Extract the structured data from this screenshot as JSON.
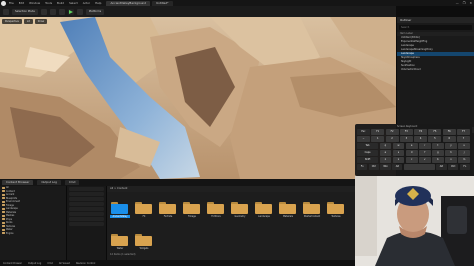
{
  "titlebar": {
    "menus": [
      "File",
      "Edit",
      "Window",
      "Tools",
      "Build",
      "Select",
      "Actor",
      "Help"
    ],
    "tabs": [
      "AncientValleyBackground",
      "Untitled*"
    ],
    "window_controls": [
      "—",
      "❐",
      "✕"
    ]
  },
  "toolbar": {
    "mode": "Selection Mode",
    "platforms": "Platforms",
    "icons": [
      "save-icon",
      "content-icon",
      "blueprint-icon",
      "cinematics-icon",
      "play-icon",
      "launch-icon"
    ]
  },
  "viewport": {
    "chips": [
      "Perspective",
      "Lit",
      "Show"
    ],
    "colors": {
      "sand": "#c9a781",
      "shadow": "#7d5d45",
      "water": "#5d86b8",
      "light": "#e2c8a4"
    }
  },
  "outliner": {
    "title": "Outliner",
    "search_placeholder": "Search",
    "column": "Item Label",
    "rows": [
      {
        "label": "Untitled (Editor)",
        "selected": false
      },
      {
        "label": "ExponentialHeightFog",
        "selected": false
      },
      {
        "label": "Landscape",
        "selected": false
      },
      {
        "label": "LandscapeStreamingProxy",
        "selected": false
      },
      {
        "label": "Landscape",
        "selected": true
      },
      {
        "label": "SkyAtmosphere",
        "selected": false
      },
      {
        "label": "SkyLight",
        "selected": false
      },
      {
        "label": "SunPosition",
        "selected": false
      },
      {
        "label": "VolumetricCloud",
        "selected": false
      }
    ]
  },
  "details": {
    "title": "Details"
  },
  "keyboard": {
    "title": "Screen Keyboard",
    "rows": [
      [
        "Esc",
        "F1",
        "F2",
        "F3",
        "F4",
        "F5",
        "F6",
        "F7"
      ],
      [
        "~",
        "1",
        "2",
        "3",
        "4",
        "5",
        "6",
        "7"
      ],
      [
        "Tab",
        "q",
        "w",
        "e",
        "r",
        "t",
        "y",
        "u"
      ],
      [
        "Caps",
        "a",
        "s",
        "d",
        "f",
        "g",
        "h",
        "j"
      ],
      [
        "Shift",
        "z",
        "x",
        "c",
        "v",
        "b",
        "n",
        "m"
      ],
      [
        "Fn",
        "Ctrl",
        "Win",
        "Alt",
        "",
        "Alt",
        "Ctrl",
        "Fn"
      ]
    ]
  },
  "bottom_tabs": [
    "Content Browser",
    "Output Log",
    "Cmd"
  ],
  "sources": {
    "rows": [
      "All",
      "Content",
      "Ancient",
      "Blueprints",
      "Environment",
      "Foliage",
      "Landscape",
      "Materials",
      "Meshes",
      "Props",
      "Rocks",
      "Textures",
      "Water",
      "Engine"
    ]
  },
  "assets": {
    "path": "All > Content",
    "folders": [
      "AncientValley",
      "FX",
      "Fortnite",
      "Foliage",
      "FortCore",
      "Geometry",
      "Landscape",
      "Materials",
      "StarterContent",
      "Textures",
      "Water",
      "Widgets"
    ],
    "count": "12 items (1 selected)"
  },
  "statusbar": [
    "Content Drawer",
    "Output Log",
    "Cmd",
    "All Saved",
    "Revision Control"
  ]
}
